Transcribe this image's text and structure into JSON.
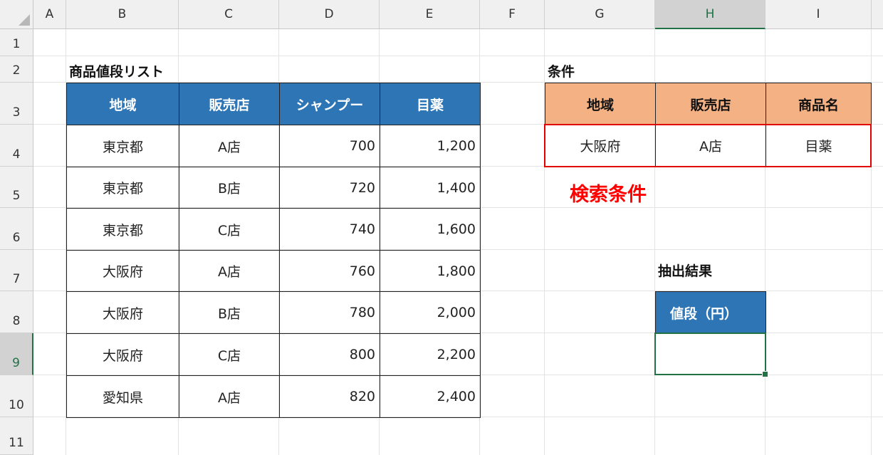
{
  "columns": [
    "A",
    "B",
    "C",
    "D",
    "E",
    "F",
    "G",
    "H",
    "I"
  ],
  "rows": [
    "1",
    "2",
    "3",
    "4",
    "5",
    "6",
    "7",
    "8",
    "9",
    "10",
    "11"
  ],
  "selected_column": "H",
  "selected_row": "9",
  "price_list": {
    "title": "商品値段リスト",
    "headers": [
      "地域",
      "販売店",
      "シャンプー",
      "目薬"
    ],
    "rows": [
      [
        "東京都",
        "A店",
        "700",
        "1,200"
      ],
      [
        "東京都",
        "B店",
        "720",
        "1,400"
      ],
      [
        "東京都",
        "C店",
        "740",
        "1,600"
      ],
      [
        "大阪府",
        "A店",
        "760",
        "1,800"
      ],
      [
        "大阪府",
        "B店",
        "780",
        "2,000"
      ],
      [
        "大阪府",
        "C店",
        "800",
        "2,200"
      ],
      [
        "愛知県",
        "A店",
        "820",
        "2,400"
      ]
    ]
  },
  "conditions": {
    "title": "条件",
    "headers": [
      "地域",
      "販売店",
      "商品名"
    ],
    "values": [
      "大阪府",
      "A店",
      "目薬"
    ],
    "note": "検索条件"
  },
  "result": {
    "title": "抽出結果",
    "header": "値段（円）",
    "value": ""
  },
  "colors": {
    "header_blue": "#2e75b6",
    "header_orange": "#f4b183",
    "highlight_red": "#e00000",
    "excel_green": "#217346"
  }
}
